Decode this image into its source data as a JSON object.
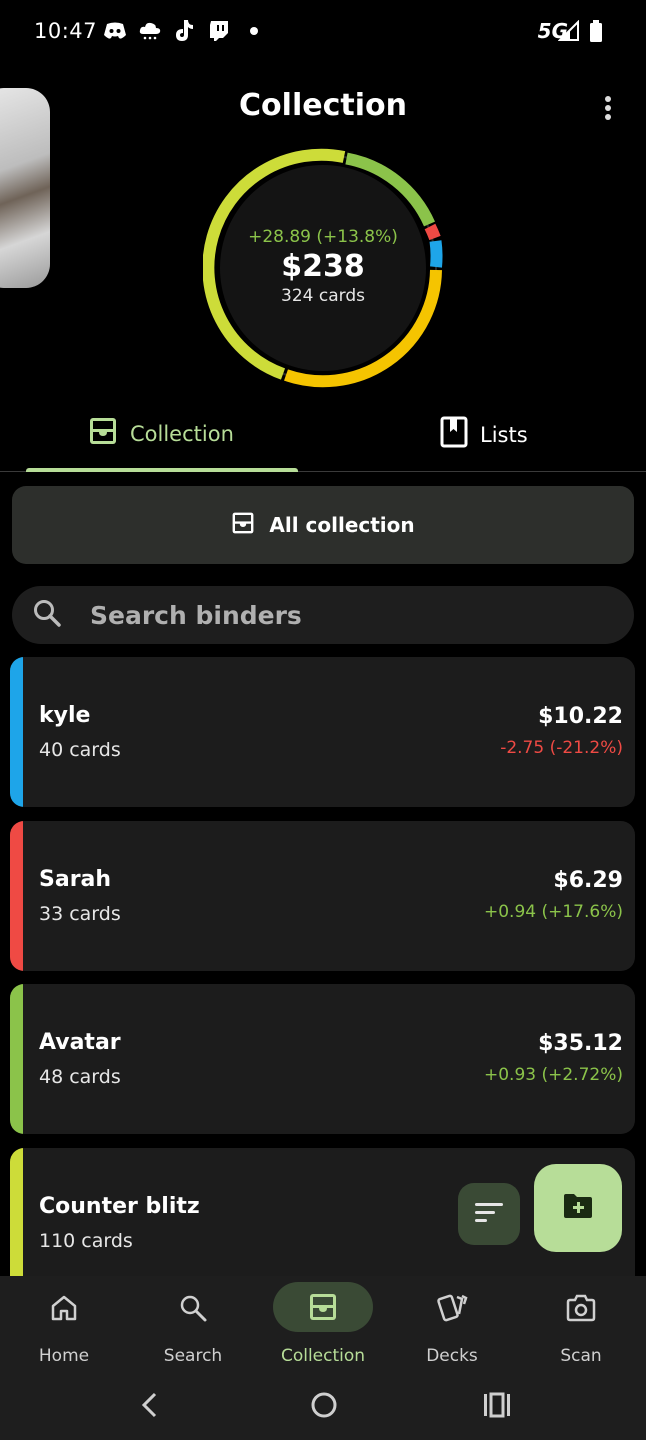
{
  "status": {
    "time": "10:47",
    "network": "5G",
    "notification_icons": [
      "discord-icon",
      "cloud-icon",
      "tiktok-icon",
      "twitch-icon",
      "dot-icon"
    ]
  },
  "header": {
    "title": "Collection"
  },
  "summary": {
    "change": "+28.89 (+13.8%)",
    "value": "$238",
    "cards": "324 cards"
  },
  "tabs": [
    {
      "label": "Collection",
      "active": true
    },
    {
      "label": "Lists",
      "active": false
    }
  ],
  "all_collection_label": "All collection",
  "search": {
    "placeholder": "Search binders"
  },
  "binders": [
    {
      "name": "kyle",
      "cards": "40 cards",
      "price": "$10.22",
      "change": "-2.75 (-21.2%)",
      "color": "#1ea5e9",
      "trend": "neg"
    },
    {
      "name": "Sarah",
      "cards": "33 cards",
      "price": "$6.29",
      "change": "+0.94 (+17.6%)",
      "color": "#ef4a44",
      "trend": "pos"
    },
    {
      "name": "Avatar",
      "cards": "48 cards",
      "price": "$35.12",
      "change": "+0.93 (+2.72%)",
      "color": "#8bc34a",
      "trend": "pos"
    },
    {
      "name": "Counter blitz",
      "cards": "110 cards",
      "price": "",
      "change": "",
      "color": "#cddc39",
      "trend": "pos"
    }
  ],
  "nav": [
    {
      "label": "Home",
      "icon": "home-icon"
    },
    {
      "label": "Search",
      "icon": "search-icon"
    },
    {
      "label": "Collection",
      "icon": "collection-icon",
      "active": true
    },
    {
      "label": "Decks",
      "icon": "decks-icon"
    },
    {
      "label": "Scan",
      "icon": "camera-icon"
    }
  ],
  "colors": {
    "accent": "#b7dd98",
    "positive": "#8bc34a",
    "negative": "#ef4a44"
  }
}
